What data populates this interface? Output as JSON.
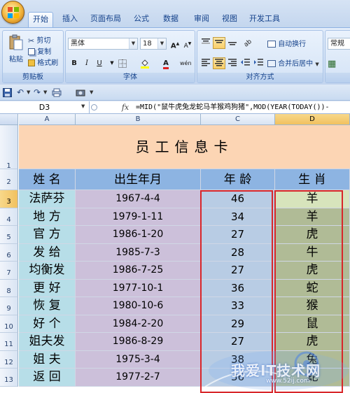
{
  "ribbon_tabs": [
    "开始",
    "插入",
    "页面布局",
    "公式",
    "数据",
    "审阅",
    "视图",
    "开发工具"
  ],
  "active_tab": "开始",
  "clipboard": {
    "paste": "粘贴",
    "cut": "剪切",
    "copy": "复制",
    "format_painter": "格式刷",
    "group_label": "剪贴板"
  },
  "font": {
    "name": "黑体",
    "size": "18",
    "grow": "A",
    "shrink": "A",
    "bold": "B",
    "italic": "I",
    "underline": "U",
    "wen": "wén",
    "group_label": "字体"
  },
  "alignment": {
    "wrap_text": "自动换行",
    "merge_center": "合并后居中",
    "group_label": "对齐方式"
  },
  "number": {
    "format": "常规"
  },
  "formula_bar": {
    "cell_ref": "D3",
    "fx": "fx",
    "formula": "=MID(\"鼠牛虎兔龙蛇马羊猴鸡狗猪\",MOD(YEAR(TODAY())-"
  },
  "columns": [
    "A",
    "B",
    "C",
    "D"
  ],
  "rows": [
    "1",
    "2",
    "3",
    "4",
    "5",
    "6",
    "7",
    "8",
    "9",
    "10",
    "11",
    "12",
    "13"
  ],
  "sheet": {
    "title": "员工信息卡",
    "headers": [
      "姓  名",
      "出生年月",
      "年 龄",
      "生 肖"
    ],
    "records": [
      {
        "name": "法萨芬",
        "birth": "1967-4-4",
        "age": "46",
        "zodiac": "羊"
      },
      {
        "name": "地  方",
        "birth": "1979-1-11",
        "age": "34",
        "zodiac": "羊"
      },
      {
        "name": "官  方",
        "birth": "1986-1-20",
        "age": "27",
        "zodiac": "虎"
      },
      {
        "name": "发  给",
        "birth": "1985-7-3",
        "age": "28",
        "zodiac": "牛"
      },
      {
        "name": "均衡发",
        "birth": "1986-7-25",
        "age": "27",
        "zodiac": "虎"
      },
      {
        "name": "更  好",
        "birth": "1977-10-1",
        "age": "36",
        "zodiac": "蛇"
      },
      {
        "name": "恢  复",
        "birth": "1980-10-6",
        "age": "33",
        "zodiac": "猴"
      },
      {
        "name": "好  个",
        "birth": "1984-2-20",
        "age": "29",
        "zodiac": "鼠"
      },
      {
        "name": "姐夫发",
        "birth": "1986-8-29",
        "age": "27",
        "zodiac": "虎"
      },
      {
        "name": "姐  夫",
        "birth": "1975-3-4",
        "age": "38",
        "zodiac": "兔"
      },
      {
        "name": "返  回",
        "birth": "1977-2-7",
        "age": "36",
        "zodiac": "蛇"
      }
    ]
  },
  "colors": {
    "title_fill": "#fcd5b4",
    "header_fill": "#8db4e2",
    "name_fill": "#b7dee8",
    "birth_fill": "#ccc0da",
    "age_fill": "#b8cce4",
    "zodiac_fill": "#c4d79b",
    "highlight": "#d8262a"
  },
  "watermark": {
    "text": "我爱IT技术网",
    "url": "www.52ij.com"
  }
}
